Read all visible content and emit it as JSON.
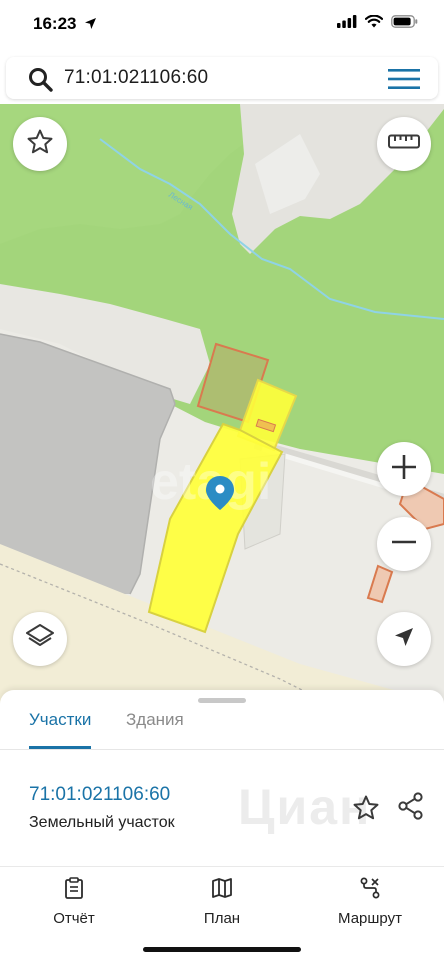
{
  "status_bar": {
    "time": "16:23",
    "icons": [
      "location-arrow-icon",
      "cellular-signal-icon",
      "wifi-icon",
      "battery-icon"
    ]
  },
  "search": {
    "value": "71:01:021106:60",
    "icons": [
      "search-icon",
      "menu-icon"
    ]
  },
  "map": {
    "road_label": "Лесная",
    "watermark": "etagi",
    "buttons": [
      "favorite-star",
      "ruler",
      "zoom-in",
      "zoom-out",
      "layers",
      "my-location"
    ],
    "colors": {
      "forest": "#a3d57b",
      "ground": "#ecebe6",
      "building": "#c3c3c1",
      "selected_parcel": "#ffff3a",
      "parcel_border": "#d97a4f",
      "water": "#8fd3e6"
    }
  },
  "sheet": {
    "tabs": [
      {
        "label": "Участки",
        "active": true
      },
      {
        "label": "Здания",
        "active": false
      }
    ],
    "parcel": {
      "number": "71:01:021106:60",
      "type": "Земельный участок"
    },
    "watermark": "Циан"
  },
  "bottom_nav": {
    "items": [
      {
        "label": "Отчёт",
        "icon": "clipboard-icon"
      },
      {
        "label": "План",
        "icon": "map-icon"
      },
      {
        "label": "Маршрут",
        "icon": "route-icon"
      }
    ]
  },
  "accent_color": "#1a73a7"
}
